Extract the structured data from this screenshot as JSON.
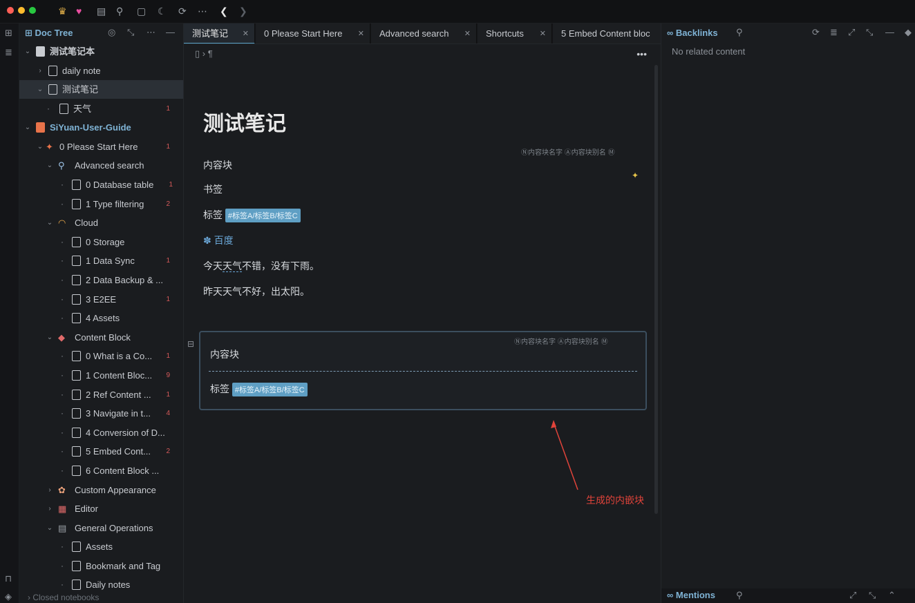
{
  "topbar": {
    "icons": [
      "crown-icon",
      "heart-icon",
      "calendar-icon",
      "search-icon",
      "square-icon",
      "moon-icon",
      "sync-icon",
      "more-icon",
      "back-icon",
      "forward-icon"
    ],
    "traffic_colors": [
      "#ff5f57",
      "#febc2e",
      "#28c840"
    ]
  },
  "tree": {
    "title": "Doc Tree",
    "items": [
      {
        "label": "测试笔记本",
        "count": ""
      },
      {
        "label": "daily note",
        "count": ""
      },
      {
        "label": "测试笔记",
        "count": ""
      },
      {
        "label": "天气",
        "count": "1"
      },
      {
        "label": "SiYuan-User-Guide",
        "count": ""
      },
      {
        "label": "0 Please Start Here",
        "count": "1"
      },
      {
        "label": "Advanced search",
        "count": ""
      },
      {
        "label": "0 Database table",
        "count": "1"
      },
      {
        "label": "1 Type filtering",
        "count": "2"
      },
      {
        "label": "Cloud",
        "count": ""
      },
      {
        "label": "0 Storage",
        "count": ""
      },
      {
        "label": "1 Data Sync",
        "count": "1"
      },
      {
        "label": "2 Data Backup & ...",
        "count": ""
      },
      {
        "label": "3 E2EE",
        "count": "1"
      },
      {
        "label": "4 Assets",
        "count": ""
      },
      {
        "label": "Content Block",
        "count": ""
      },
      {
        "label": "0 What is a Co...",
        "count": "1"
      },
      {
        "label": "1 Content Bloc...",
        "count": "9"
      },
      {
        "label": "2 Ref Content ...",
        "count": "1"
      },
      {
        "label": "3 Navigate in t...",
        "count": "4"
      },
      {
        "label": "4 Conversion of D...",
        "count": ""
      },
      {
        "label": "5 Embed Cont...",
        "count": "2"
      },
      {
        "label": "6 Content Block ...",
        "count": ""
      },
      {
        "label": "Custom Appearance",
        "count": ""
      },
      {
        "label": "Editor",
        "count": ""
      },
      {
        "label": "General Operations",
        "count": ""
      },
      {
        "label": "Assets",
        "count": ""
      },
      {
        "label": "Bookmark and Tag",
        "count": ""
      },
      {
        "label": "Daily notes",
        "count": ""
      }
    ],
    "closed_notebooks": "Closed notebooks"
  },
  "tabs": [
    {
      "label": "测试笔记"
    },
    {
      "label": "0 Please Start Here"
    },
    {
      "label": "Advanced search"
    },
    {
      "label": "Shortcuts"
    },
    {
      "label": "5 Embed Content bloc"
    }
  ],
  "editor": {
    "title": "测试笔记",
    "attr_name": "Ⓝ内容块名字",
    "attr_alias": "Ⓐ内容块别名",
    "attr_memo": "Ⓜ",
    "lines": [
      "内容块",
      "书签",
      "标签",
      "百度",
      "今天",
      "天气",
      "不错，没有下雨。",
      "昨天天气不好，出太阳。"
    ],
    "tag": "#标签A/标签B/标签C",
    "embed": {
      "line1": "内容块",
      "line2": "标签",
      "tag": "#标签A/标签B/标签C"
    },
    "annotation": "生成的内嵌块",
    "annotation_color": "#e0433a"
  },
  "backlinks": {
    "title": "Backlinks",
    "empty": "No related content",
    "mentions_title": "Mentions"
  }
}
